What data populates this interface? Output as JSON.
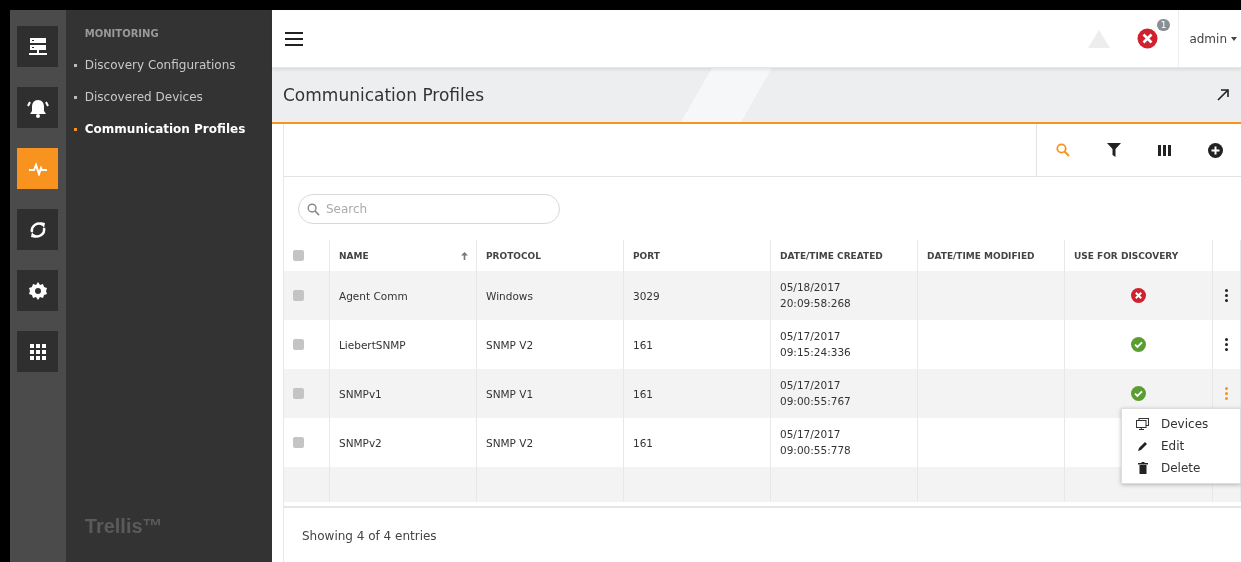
{
  "rail": {
    "items": [
      {
        "kind": "server",
        "selected": false
      },
      {
        "kind": "alarm",
        "selected": false
      },
      {
        "kind": "pulse",
        "selected": true
      },
      {
        "kind": "sync",
        "selected": false
      },
      {
        "kind": "gear",
        "selected": false
      },
      {
        "kind": "grid",
        "selected": false
      }
    ]
  },
  "sidebar": {
    "section": "MONITORING",
    "items": [
      {
        "label": "Discovery Configurations",
        "selected": false
      },
      {
        "label": "Discovered Devices",
        "selected": false
      },
      {
        "label": "Communication Profiles",
        "selected": true
      }
    ],
    "brand": "Trellis™"
  },
  "topbar": {
    "alarm_count": "1",
    "user": "admin"
  },
  "page": {
    "title": "Communication Profiles"
  },
  "toolbar": {
    "tools": [
      {
        "kind": "search",
        "selected": true
      },
      {
        "kind": "filter",
        "selected": false
      },
      {
        "kind": "columns",
        "selected": false
      },
      {
        "kind": "add",
        "selected": false
      }
    ]
  },
  "search": {
    "placeholder": "Search"
  },
  "table": {
    "select_all_checked": false,
    "columns": [
      {
        "label": "NAME",
        "sorted": true
      },
      {
        "label": "PROTOCOL",
        "sorted": false
      },
      {
        "label": "PORT",
        "sorted": false
      },
      {
        "label": "DATE/TIME CREATED",
        "sorted": false
      },
      {
        "label": "DATE/TIME MODIFIED",
        "sorted": false
      },
      {
        "label": "USE FOR DISCOVERY",
        "sorted": false
      }
    ],
    "rows": [
      {
        "checked": false,
        "name": "Agent Comm",
        "protocol": "Windows",
        "port": "3029",
        "created_date": "05/18/2017",
        "created_time": "20:09:58:268",
        "use_for_discovery": false,
        "menu_open": false
      },
      {
        "checked": false,
        "name": "LiebertSNMP",
        "protocol": "SNMP V2",
        "port": "161",
        "created_date": "05/17/2017",
        "created_time": "09:15:24:336",
        "use_for_discovery": true,
        "menu_open": false
      },
      {
        "checked": false,
        "name": "SNMPv1",
        "protocol": "SNMP V1",
        "port": "161",
        "created_date": "05/17/2017",
        "created_time": "09:00:55:767",
        "use_for_discovery": true,
        "menu_open": true
      },
      {
        "checked": false,
        "name": "SNMPv2",
        "protocol": "SNMP V2",
        "port": "161",
        "created_date": "05/17/2017",
        "created_time": "09:00:55:778"
      }
    ]
  },
  "context_menu": {
    "items": [
      {
        "kind": "devices",
        "label": "Devices"
      },
      {
        "kind": "edit",
        "label": "Edit"
      },
      {
        "kind": "delete",
        "label": "Delete"
      }
    ]
  },
  "footer": {
    "summary": "Showing 4 of 4 entries"
  }
}
